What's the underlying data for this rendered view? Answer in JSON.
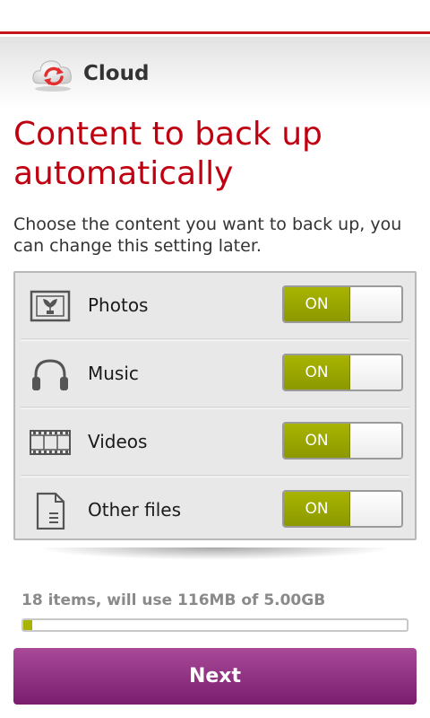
{
  "header": {
    "app_title": "Cloud",
    "logo_icon": "cloud-sync-icon"
  },
  "page": {
    "title": "Content to back up automatically",
    "subtitle": "Choose the content you want to back up, you can change this setting later."
  },
  "options": [
    {
      "label": "Photos",
      "icon": "photo-icon",
      "state": "ON"
    },
    {
      "label": "Music",
      "icon": "headphones-icon",
      "state": "ON"
    },
    {
      "label": "Videos",
      "icon": "film-strip-icon",
      "state": "ON"
    },
    {
      "label": "Other files",
      "icon": "document-icon",
      "state": "ON"
    }
  ],
  "storage": {
    "summary": "18 items, will use 116MB of 5.00GB",
    "used_fraction": 0.0227
  },
  "actions": {
    "next_label": "Next"
  },
  "colors": {
    "accent_red": "#c4161c",
    "title_red": "#c00010",
    "toggle_green": "#a8b400",
    "button_purple": "#8e2a82"
  }
}
